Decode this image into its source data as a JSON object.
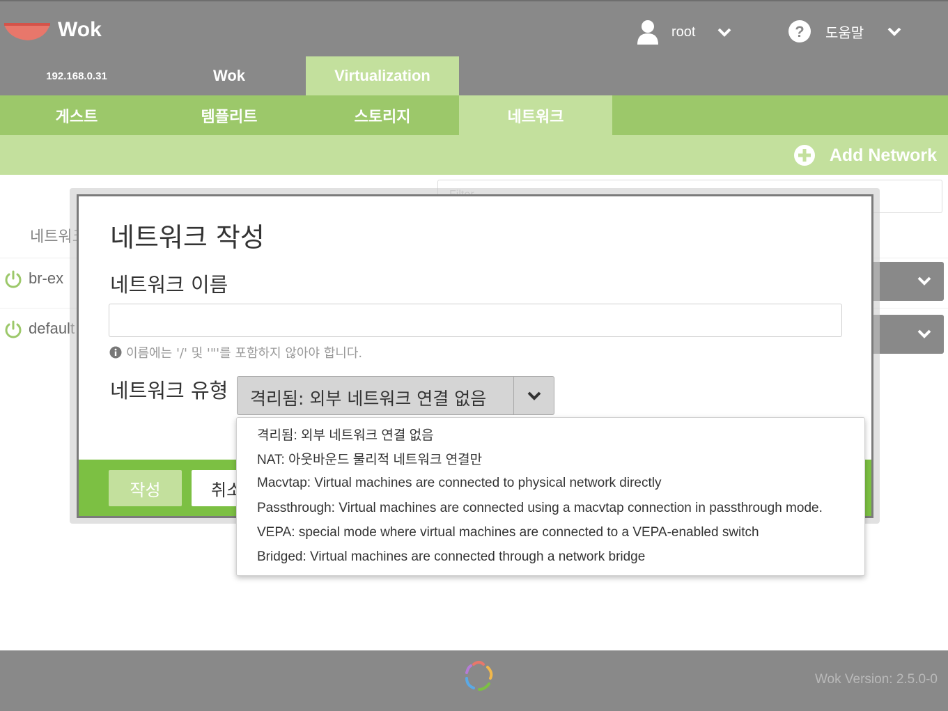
{
  "header": {
    "brand": "Wok",
    "user": "root",
    "help": "도움말"
  },
  "main_tabs": [
    {
      "label": "192.168.0.31"
    },
    {
      "label": "Wok"
    },
    {
      "label": "Virtualization"
    }
  ],
  "sub_tabs": [
    {
      "label": "게스트"
    },
    {
      "label": "템플리트"
    },
    {
      "label": "스토리지"
    },
    {
      "label": "네트워크"
    }
  ],
  "action_bar": {
    "add_network": "Add Network"
  },
  "background": {
    "filter_placeholder": "Filter",
    "list_header": "네트워크 이름",
    "networks": [
      {
        "name": "br-ex"
      },
      {
        "name": "default"
      }
    ]
  },
  "modal": {
    "title": "네트워크 작성",
    "name_label": "네트워크 이름",
    "name_value": "",
    "hint": "이름에는 '/' 및 '\"'를 포함하지 않아야 합니다.",
    "type_label": "네트워크 유형",
    "type_selected": "격리됨: 외부 네트워크 연결 없음",
    "create_button": "작성",
    "cancel_button": "취소"
  },
  "dropdown": {
    "options": [
      "격리됨: 외부 네트워크 연결 없음",
      "NAT: 아웃바운드 물리적 네트워크 연결만",
      "Macvtap: Virtual machines are connected to physical network directly",
      "Passthrough: Virtual machines are connected using a macvtap connection in passthrough mode.",
      "VEPA: special mode where virtual machines are connected to a VEPA-enabled switch",
      "Bridged: Virtual machines are connected through a network bridge"
    ]
  },
  "footer": {
    "version": "Wok Version: 2.5.0-0"
  },
  "colors": {
    "header_gray": "#898989",
    "green_dark": "#7cc043",
    "green_mid": "#9cc86a",
    "green_light": "#c3e09d",
    "logo_red": "#e8776b"
  },
  "icons": [
    "wok-bowl-logo",
    "user-icon",
    "chevron-down-icon",
    "help-icon",
    "plus-circle-icon",
    "power-icon",
    "info-icon",
    "kimchi-footer-logo"
  ]
}
